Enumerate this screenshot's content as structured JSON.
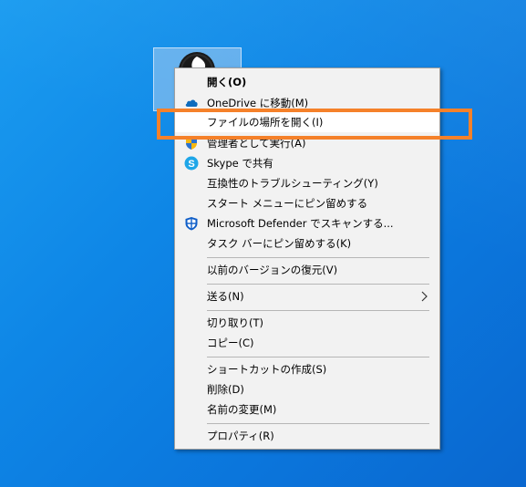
{
  "menu": {
    "items": [
      {
        "label": "開く(O)",
        "icon": "none"
      },
      {
        "label": "OneDrive に移動(M)",
        "icon": "onedrive-icon"
      },
      {
        "label": "ファイルの場所を開く(I)",
        "icon": "none"
      },
      {
        "label": "管理者として実行(A)",
        "icon": "shield-icon"
      },
      {
        "label": "Skype で共有",
        "icon": "skype-icon"
      },
      {
        "label": "互換性のトラブルシューティング(Y)",
        "icon": "none"
      },
      {
        "label": "スタート メニューにピン留めする",
        "icon": "none"
      },
      {
        "label": "Microsoft Defender でスキャンする...",
        "icon": "defender-icon"
      },
      {
        "label": "タスク バーにピン留めする(K)",
        "icon": "none"
      },
      {
        "label": "以前のバージョンの復元(V)",
        "icon": "none"
      },
      {
        "label": "送る(N)",
        "icon": "chevron-right-icon"
      },
      {
        "label": "切り取り(T)",
        "icon": "none"
      },
      {
        "label": "コピー(C)",
        "icon": "none"
      },
      {
        "label": "ショートカットの作成(S)",
        "icon": "none"
      },
      {
        "label": "削除(D)",
        "icon": "none"
      },
      {
        "label": "名前の変更(M)",
        "icon": "none"
      },
      {
        "label": "プロパティ(R)",
        "icon": "none"
      }
    ]
  },
  "colors": {
    "desktop_blue": "#0e86e6",
    "menu_background": "#f2f2f2",
    "highlight_border": "#f5812a"
  }
}
